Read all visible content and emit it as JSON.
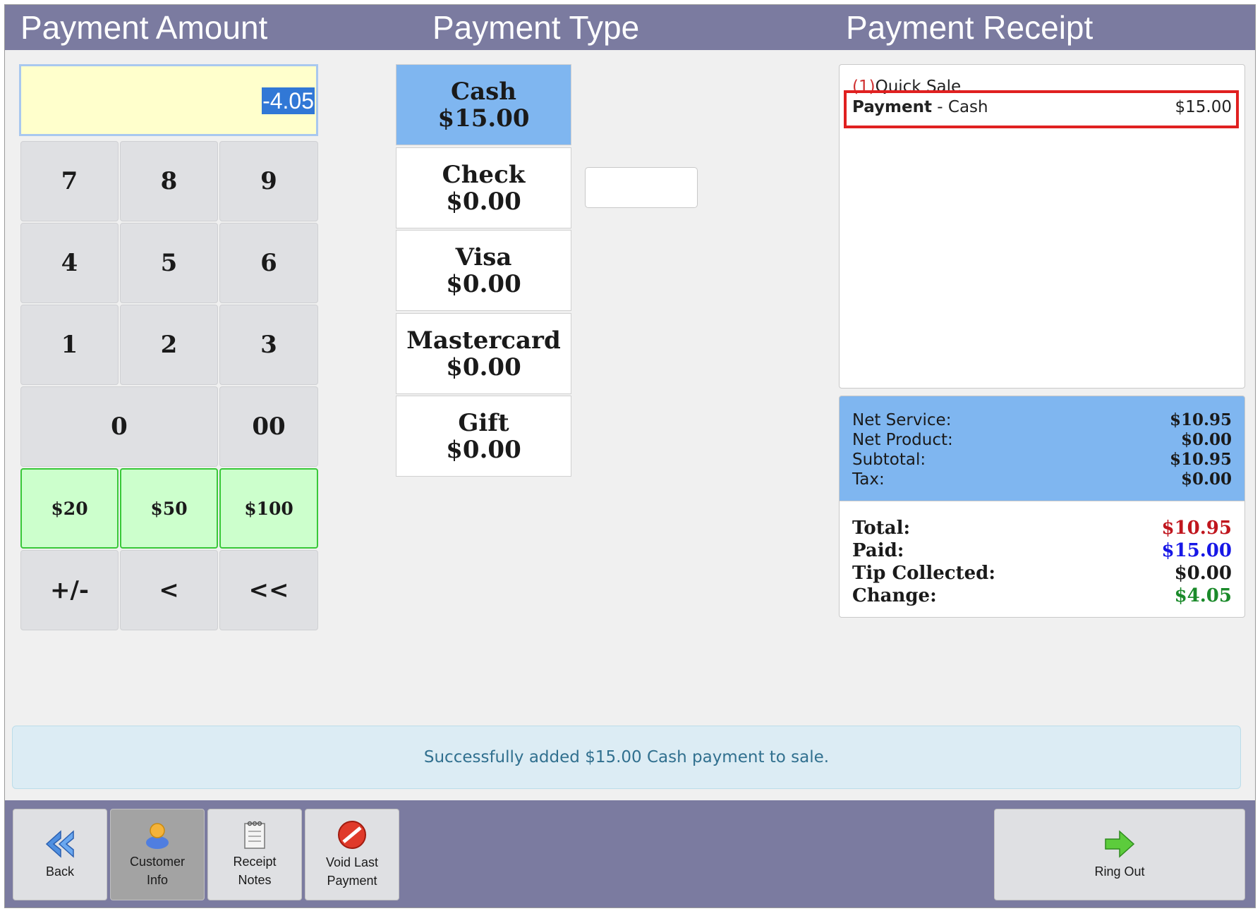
{
  "headers": {
    "payment_amount": "Payment Amount",
    "payment_type": "Payment Type",
    "payment_receipt": "Payment Receipt"
  },
  "amount_value": "-4.05",
  "keypad": {
    "k7": "7",
    "k8": "8",
    "k9": "9",
    "k4": "4",
    "k5": "5",
    "k6": "6",
    "k1": "1",
    "k2": "2",
    "k3": "3",
    "k0": "0",
    "k00": "00",
    "q20": "$20",
    "q50": "$50",
    "q100": "$100",
    "plusminus": "+/-",
    "back": "<",
    "clear": "<<"
  },
  "payment_types": [
    {
      "name": "Cash",
      "amount": "$15.00"
    },
    {
      "name": "Check",
      "amount": "$0.00"
    },
    {
      "name": "Visa",
      "amount": "$0.00"
    },
    {
      "name": "Mastercard",
      "amount": "$0.00"
    },
    {
      "name": "Gift",
      "amount": "$0.00"
    }
  ],
  "receipt": {
    "line_index": "(1)",
    "line_item": "Quick Sale",
    "payment_label": "Payment",
    "payment_sep": " - ",
    "payment_method": "Cash",
    "payment_amount": "$15.00"
  },
  "totals_top": [
    {
      "label": "Net Service:",
      "value": "$10.95"
    },
    {
      "label": "Net Product:",
      "value": "$0.00"
    },
    {
      "label": "Subtotal:",
      "value": "$10.95"
    },
    {
      "label": "Tax:",
      "value": "$0.00"
    }
  ],
  "totals_bottom": [
    {
      "label": "Total:",
      "value": "$10.95"
    },
    {
      "label": "Paid:",
      "value": "$15.00"
    },
    {
      "label": "Tip Collected:",
      "value": "$0.00"
    },
    {
      "label": "Change:",
      "value": "$4.05"
    }
  ],
  "colors": {
    "total": "#c0161e",
    "paid": "#1717e6",
    "change": "#1a8a2a",
    "header_bar": "#7b7ba0",
    "selected_type": "#7fb6f0"
  },
  "message": "Successfully added $15.00 Cash payment to sale.",
  "buttons": {
    "back": "Back",
    "customer_line1": "Customer",
    "customer_line2": "Info",
    "notes_line1": "Receipt",
    "notes_line2": "Notes",
    "void_line1": "Void Last",
    "void_line2": "Payment",
    "ring_out": "Ring Out"
  }
}
